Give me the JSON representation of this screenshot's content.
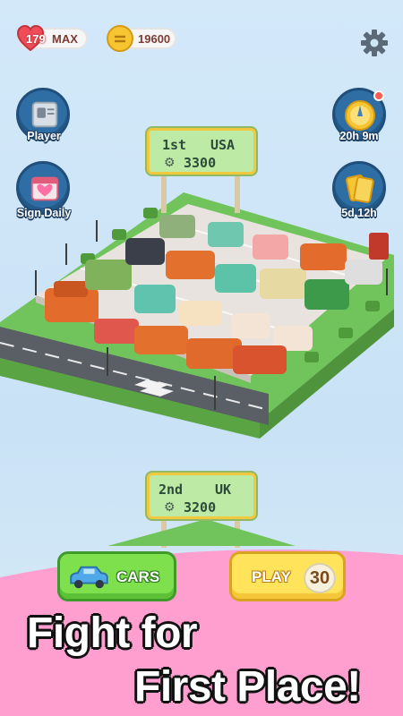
{
  "hud": {
    "energy_value": "179",
    "energy_max_label": "MAX",
    "coins_value": "19600"
  },
  "side_buttons": {
    "player_label": "Player",
    "sign_daily_label": "Sign Daily",
    "timer_1_label": "20h 9m",
    "timer_2_label": "5d 12h"
  },
  "leaderboard": [
    {
      "rank": "1st",
      "country": "USA",
      "score": "3300"
    },
    {
      "rank": "2nd",
      "country": "UK",
      "score": "3200"
    }
  ],
  "actions": {
    "cars_label": "CARS",
    "play_label": "PLAY",
    "play_cost": "30"
  },
  "banner": {
    "line1": "Fight for",
    "line2": "First Place!"
  },
  "colors": {
    "sky": "#cfe6f7",
    "grass": "#6fbf5a",
    "road": "#5a5f66",
    "banner_pink": "#ff9fd0",
    "cars_button": "#7ee04c",
    "play_button": "#ffe35a"
  }
}
